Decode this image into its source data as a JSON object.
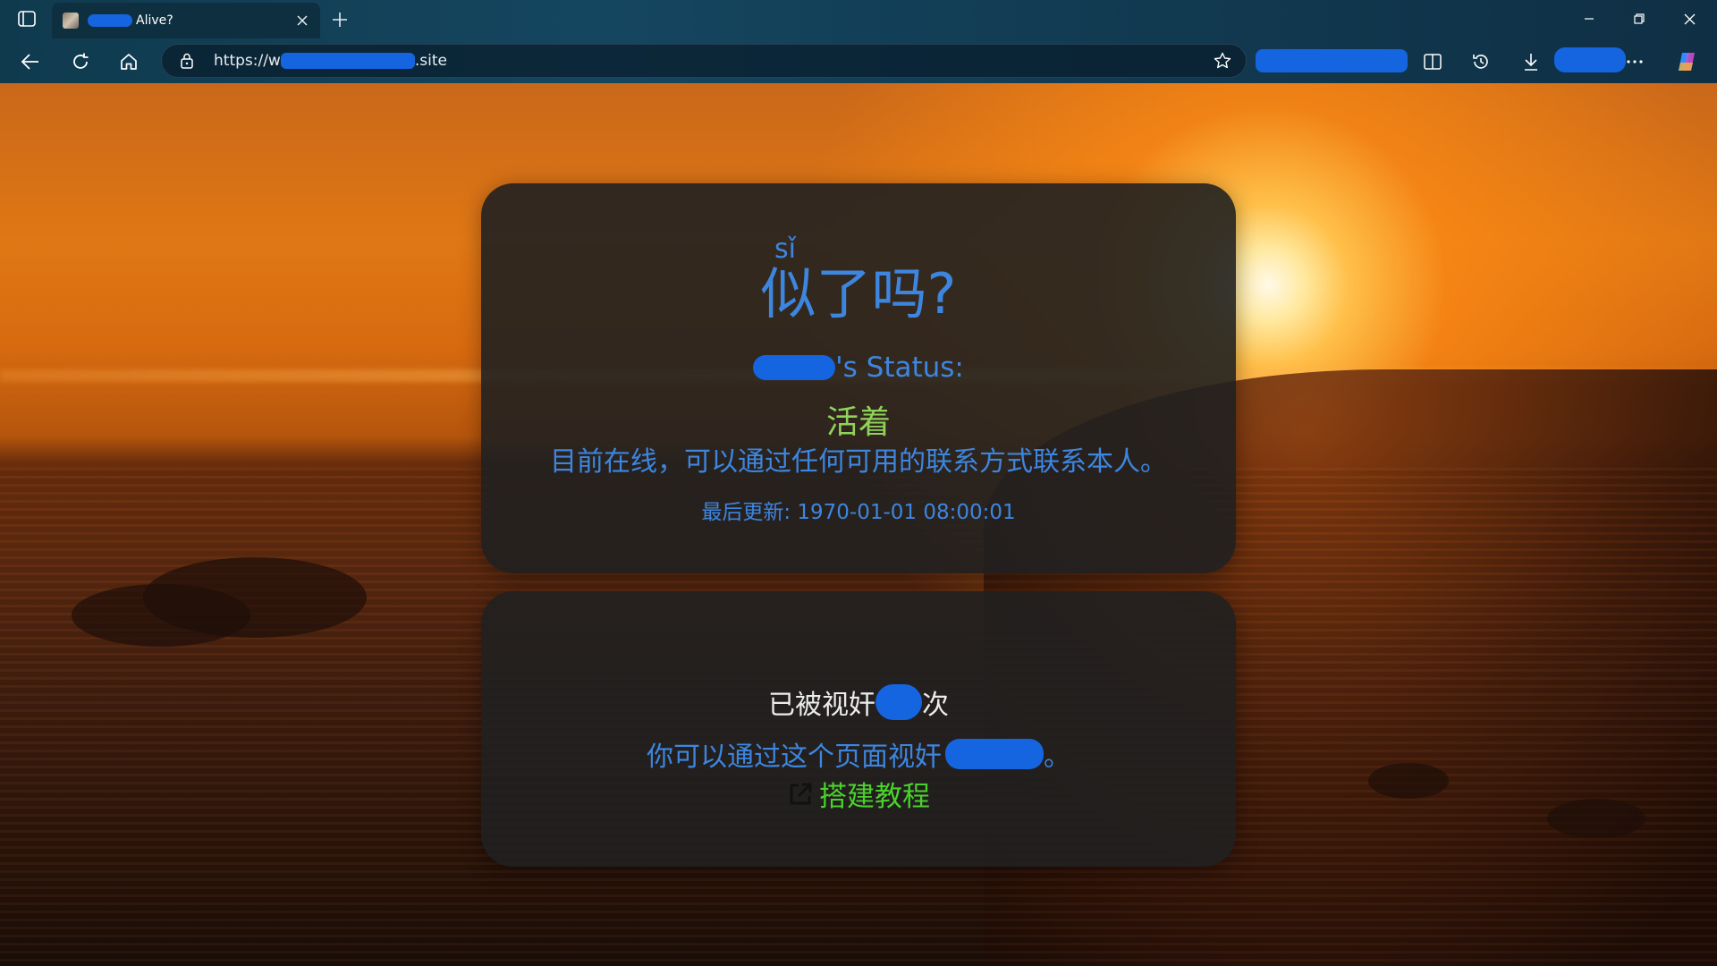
{
  "browser": {
    "tab": {
      "title": "Alive?"
    },
    "address_bar": {
      "url_prefix": "https://w",
      "url_suffix": ".site"
    }
  },
  "page": {
    "card_status": {
      "ruby": "sǐ",
      "title": "似了吗?",
      "status_label": "'s Status:",
      "status_value": "活着",
      "status_desc": "目前在线，可以通过任何可用的联系方式联系本人。",
      "last_update": "最后更新: 1970-01-01 08:00:01"
    },
    "card_visits": {
      "count_prefix": "已被视奸",
      "count_suffix": "次",
      "desc_prefix": "你可以通过这个页面视奸",
      "desc_suffix": "。",
      "tutorial_label": "搭建教程"
    }
  },
  "colors": {
    "title_blue": "#3d86e0",
    "alive_green": "#8fd35a",
    "link_green": "#4ad12c",
    "redaction_blue": "#1565e0"
  },
  "icons": [
    "tab-actions-icon",
    "close-icon",
    "plus-icon",
    "minimize-icon",
    "restore-icon",
    "back-icon",
    "refresh-icon",
    "home-icon",
    "lock-icon",
    "star-icon",
    "split-screen-icon",
    "history-icon",
    "download-icon",
    "more-icon",
    "copilot-icon",
    "external-link-icon"
  ]
}
